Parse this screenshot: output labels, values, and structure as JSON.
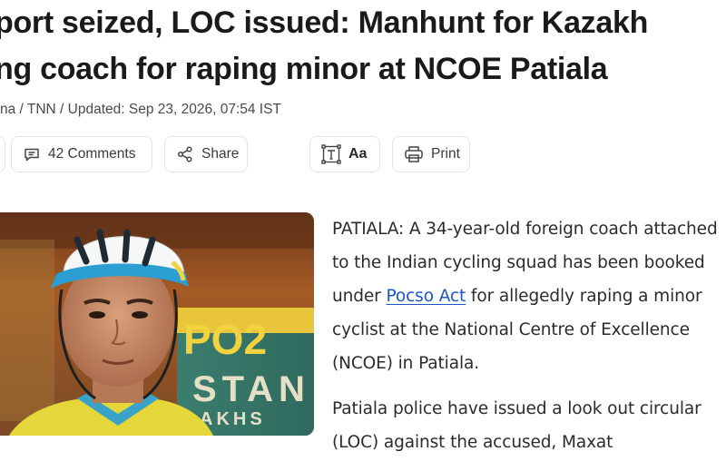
{
  "article": {
    "headline_line1": "port seized, LOC issued: Manhunt for Kazakh",
    "headline_line2": "ng coach for raping minor at NCOE Patiala",
    "byline": "na / TNN / Updated: Sep 23, 2026, 07:54 IST"
  },
  "toolbar": {
    "comments_label": "42 Comments",
    "share_label": "Share",
    "text_size_label": "Aa",
    "print_label": "Print"
  },
  "image": {
    "sign_text_top": "PO2",
    "sign_text_mid": "STAN",
    "sign_text_bottom": "AKHS"
  },
  "body": {
    "p1_before_link": "PATIALA: A 34-year-old foreign coach attached to the Indian cycling squad has been booked under ",
    "p1_link": "Pocso Act",
    "p1_after_link": " for allegedly raping a minor cyclist at the National Centre of Excellence (NCOE) in Patiala.",
    "p2": "Patiala police have issued a look out circular (LOC) against the accused, Maxat"
  },
  "colors": {
    "link": "#1a55c9",
    "text": "#2b2b2b",
    "border": "#e3e3e3"
  }
}
